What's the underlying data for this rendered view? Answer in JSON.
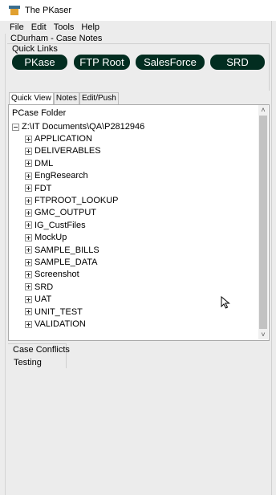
{
  "window": {
    "title": "The PKaser"
  },
  "menu": [
    "File",
    "Edit",
    "Tools",
    "Help"
  ],
  "case_label": "CDurham - Case Notes",
  "quick_links": {
    "label": "Quick Links",
    "buttons": [
      "PKase",
      "FTP Root",
      "SalesForce",
      "SRD"
    ]
  },
  "tabs": [
    "Quick View",
    "Notes",
    "Edit/Push"
  ],
  "active_tab": "Quick View",
  "folder": {
    "header": "PCase Folder",
    "root": "Z:\\IT Documents\\QA\\P2812946",
    "items": [
      "APPLICATION",
      "DELIVERABLES",
      "DML",
      "EngResearch",
      "FDT",
      "FTPROOT_LOOKUP",
      "GMC_OUTPUT",
      "IG_CustFiles",
      "MockUp",
      "SAMPLE_BILLS",
      "SAMPLE_DATA",
      "Screenshot",
      "SRD",
      "UAT",
      "UNIT_TEST",
      "VALIDATION"
    ]
  },
  "case_conflicts": {
    "label": "Case Conflicts",
    "items": [
      "Testing"
    ]
  },
  "icons": {
    "expander_collapsed": "plus-box-icon",
    "expander_expanded": "minus-box-icon",
    "scroll_up": "chevron-up-icon",
    "scroll_down": "chevron-down-icon",
    "cursor": "mouse-pointer-icon",
    "app": "app-icon"
  },
  "colors": {
    "quick_link_bg": "#022d20",
    "quick_link_text": "#ffffff"
  }
}
